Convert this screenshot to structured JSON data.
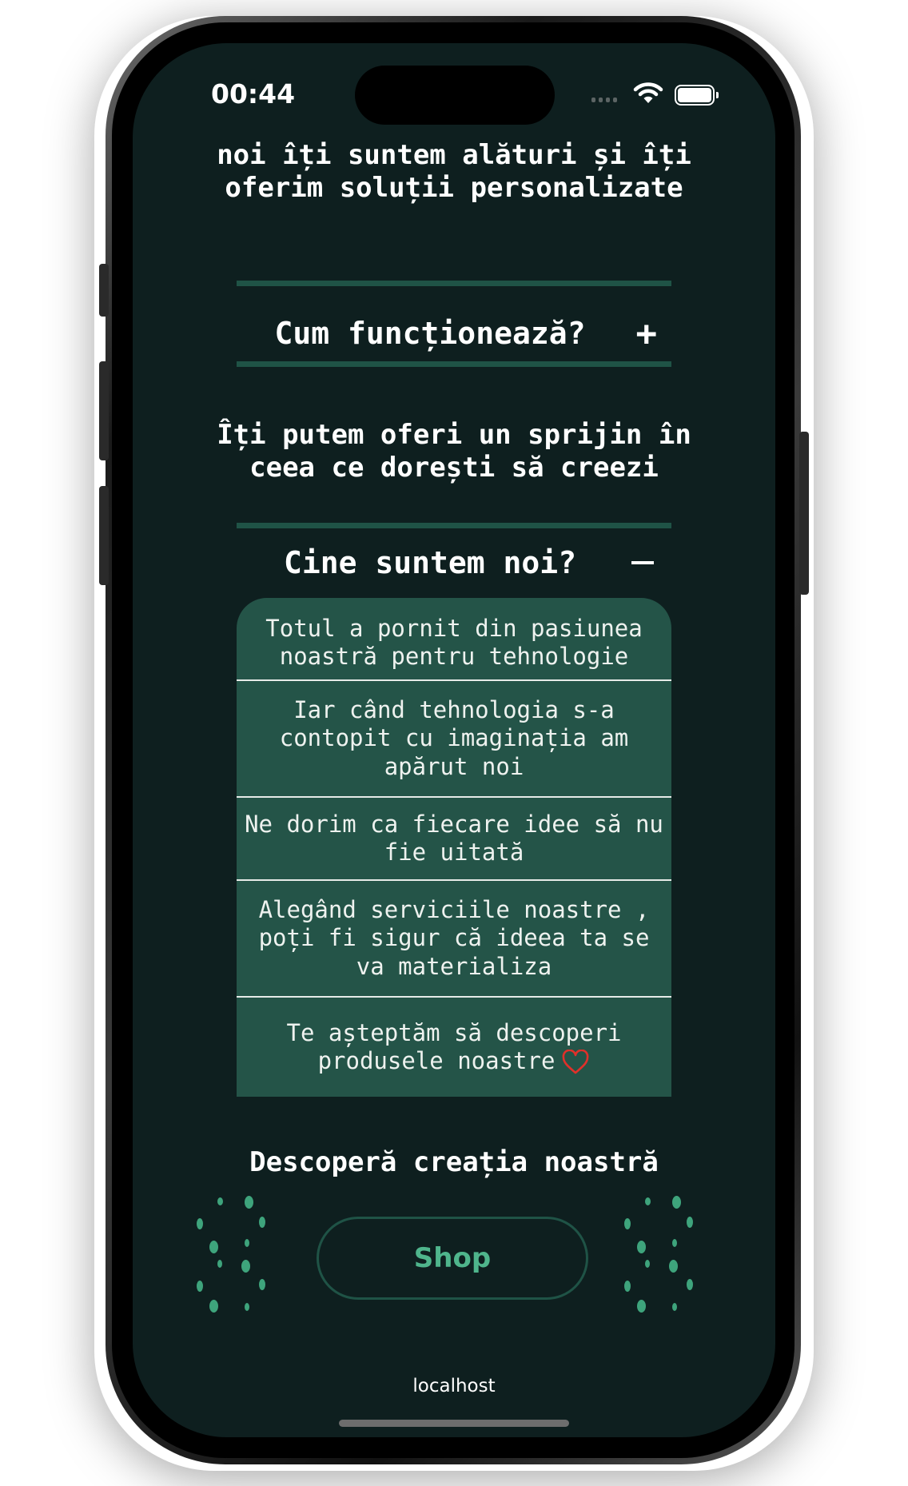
{
  "status_bar": {
    "time": "00:44"
  },
  "intro_text": "noi îți suntem alături și îți oferim soluții personalizate",
  "accordion": [
    {
      "title": "Cum funcționează?",
      "toggle": "+",
      "expanded": false,
      "body": "Îți putem oferi un sprijin în ceea ce dorești să creezi"
    },
    {
      "title": "Cine suntem noi?",
      "toggle": "−",
      "expanded": true,
      "items": [
        "Totul a pornit din pasiunea noastră pentru tehnologie",
        "Iar când tehnologia s-a contopit cu imaginația am apărut noi",
        "Ne dorim ca fiecare idee să nu fie uitată",
        "Alegând serviciile noastre , poți fi sigur că ideea ta se va materializa",
        "Te așteptăm să descoperi produsele noastre"
      ]
    }
  ],
  "cta": {
    "title": "Descoperă creația noastră",
    "button_label": "Shop"
  },
  "browser": {
    "url": "localhost"
  },
  "colors": {
    "background": "#0e1f1f",
    "accent": "#1f5346",
    "card": "#245448",
    "button_text": "#4fb58c",
    "heart": "#e0302a"
  },
  "icons": {
    "heart": "heart-outline-icon",
    "wifi": "wifi-icon",
    "battery": "battery-icon"
  }
}
